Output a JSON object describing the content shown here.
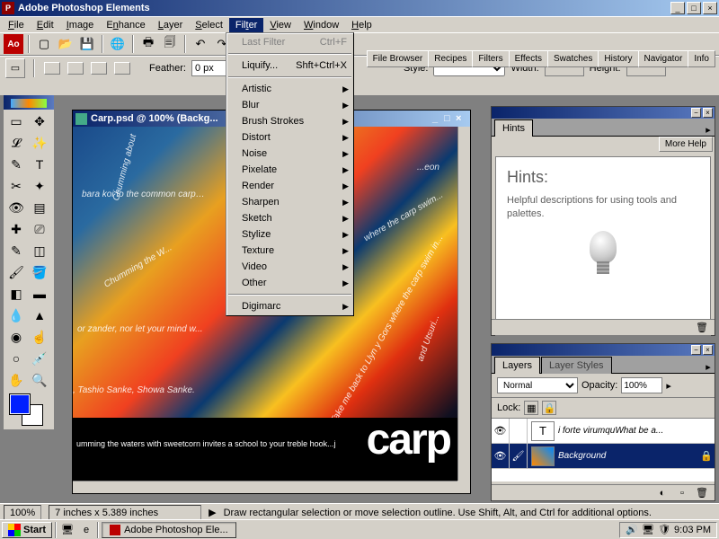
{
  "app": {
    "title": "Adobe Photoshop Elements"
  },
  "menubar": [
    "File",
    "Edit",
    "Image",
    "Enhance",
    "Layer",
    "Select",
    "Filter",
    "View",
    "Window",
    "Help"
  ],
  "filter_menu": {
    "last_filter": "Last Filter",
    "last_filter_sc": "Ctrl+F",
    "liquify": "Liquify...",
    "liquify_sc": "Shft+Ctrl+X",
    "items": [
      "Artistic",
      "Blur",
      "Brush Strokes",
      "Distort",
      "Noise",
      "Pixelate",
      "Render",
      "Sharpen",
      "Sketch",
      "Stylize",
      "Texture",
      "Video",
      "Other"
    ],
    "digimarc": "Digimarc"
  },
  "shortcuts": [
    "File Browser",
    "Recipes",
    "Filters",
    "Effects",
    "Swatches",
    "History",
    "Navigator",
    "Info"
  ],
  "options": {
    "feather_label": "Feather:",
    "feather_val": "0 px",
    "style_label": "Style:",
    "width_label": "Width:",
    "height_label": "Height:"
  },
  "doc": {
    "title": "Carp.psd @ 100% (Backg...",
    "big": "carp",
    "t1": "Chumming about",
    "t2": "bara koi to the common carp…",
    "t3": "Chumming the W...",
    "t4": "or zander, nor let your mind w...",
    "t5": ", Tashio Sanke, Showa Sanke.",
    "t6": "Take me back to Llyn y Gors where the carp swim in...",
    "t7": "...eon",
    "t8": "where the carp swim...",
    "t9": "and Utsuri...",
    "strip": "umming the waters with sweetcorn invites a school to your treble hook...j"
  },
  "hints": {
    "tab": "Hints",
    "more": "More Help",
    "heading": "Hints:",
    "body": "Helpful descriptions for using tools and palettes."
  },
  "layers": {
    "tab1": "Layers",
    "tab2": "Layer Styles",
    "blend": "Normal",
    "opacity_label": "Opacity:",
    "opacity_val": "100%",
    "lock_label": "Lock:",
    "row1": "i forte virumquWhat be a...",
    "row2": "Background"
  },
  "status": {
    "zoom": "100%",
    "dims": "7 inches x 5.389 inches",
    "hint": "Draw rectangular selection or move selection outline.  Use Shift, Alt, and Ctrl for additional options."
  },
  "taskbar": {
    "start": "Start",
    "task": "Adobe Photoshop Ele...",
    "time": "9:03 PM"
  }
}
